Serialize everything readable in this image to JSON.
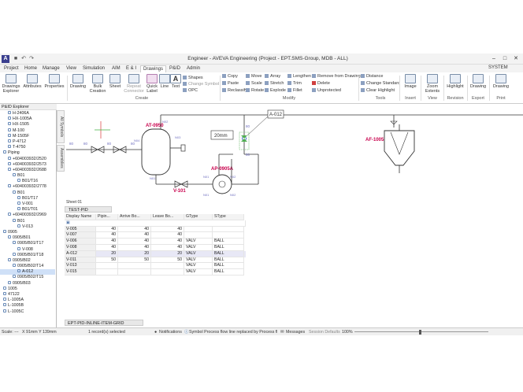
{
  "app": {
    "title": "Engineer - AVEVA Engineering (Project - EPT.SMS-Group, MDB - ALL)",
    "logo": "A",
    "user": "SYSTEM"
  },
  "menu_tabs": [
    "Project",
    "Home",
    "Manage",
    "View",
    "Simulation",
    "AIM",
    "E & I",
    "Drawings",
    "P&ID",
    "Admin"
  ],
  "active_tab": "Drawings",
  "ribbon": {
    "groups": {
      "create": "Create",
      "modify": "Modify",
      "tools": "Tools",
      "insert": "Insert",
      "view": "View",
      "revision": "Revision",
      "export": "Export",
      "print": "Print"
    },
    "drawings_explorer": "Drawings Explorer",
    "attributes": "Attributes",
    "properties": "Properties",
    "drawing": "Drawing",
    "bulk_creation": "Bulk Creation",
    "sheet": "Sheet",
    "repeat_connector": "Repeat Connector",
    "quick_label": "Quick Label",
    "line": "Line",
    "text": "Text",
    "shapes": "Shapes",
    "change_symbol": "Change Symbol",
    "opc": "OPC",
    "copy": "Copy",
    "paste": "Paste",
    "reclassify": "Reclassify",
    "move": "Move",
    "scale": "Scale",
    "rotate": "Rotate",
    "array": "Array",
    "stretch": "Stretch",
    "explode": "Explode",
    "lengthen": "Lengthen",
    "trim": "Trim",
    "fillet": "Fillet",
    "remove_from_drawing": "Remove from Drawing",
    "delete": "Delete",
    "unprotected": "Unprotected",
    "distance": "Distance",
    "change_standard": "Change Standard",
    "clear_highlight": "Clear Highlight",
    "image": "Image",
    "zoom_extents": "Zoom Extents",
    "highlight": "Highlight",
    "drawing_export": "Drawing",
    "drawing_print": "Drawing"
  },
  "explorer": {
    "title": "P&ID Explorer",
    "items": [
      {
        "label": "H-2406A",
        "indent": 1,
        "selected": false
      },
      {
        "label": "HX-1005A",
        "indent": 1,
        "selected": false
      },
      {
        "label": "HX-1505",
        "indent": 1,
        "selected": false
      },
      {
        "label": "M-100",
        "indent": 1,
        "selected": false
      },
      {
        "label": "M-1505F",
        "indent": 1,
        "selected": false
      },
      {
        "label": "P-4712",
        "indent": 1,
        "selected": false
      },
      {
        "label": "T-4750",
        "indent": 1,
        "selected": false
      },
      {
        "label": "Piping",
        "indent": 0,
        "selected": false
      },
      {
        "label": "+604003932/2520",
        "indent": 1,
        "selected": false
      },
      {
        "label": "+604003932/2573",
        "indent": 1,
        "selected": false
      },
      {
        "label": "+604003932/2688",
        "indent": 1,
        "selected": false
      },
      {
        "label": "B01",
        "indent": 2,
        "selected": false
      },
      {
        "label": "B01/T16",
        "indent": 3,
        "selected": false
      },
      {
        "label": "+604003932/2778",
        "indent": 1,
        "selected": false
      },
      {
        "label": "B01",
        "indent": 2,
        "selected": false
      },
      {
        "label": "B01/T17",
        "indent": 3,
        "selected": false
      },
      {
        "label": "V-001",
        "indent": 3,
        "selected": false
      },
      {
        "label": "B01/T01",
        "indent": 3,
        "selected": false
      },
      {
        "label": "+604003932/2969",
        "indent": 1,
        "selected": false
      },
      {
        "label": "B01",
        "indent": 2,
        "selected": false
      },
      {
        "label": "V-013",
        "indent": 3,
        "selected": false
      },
      {
        "label": "0905",
        "indent": 0,
        "selected": false
      },
      {
        "label": "0905/B01",
        "indent": 1,
        "selected": false
      },
      {
        "label": "0905/B01/T17",
        "indent": 2,
        "selected": false
      },
      {
        "label": "V-008",
        "indent": 3,
        "selected": false
      },
      {
        "label": "0905/B01/T18",
        "indent": 2,
        "selected": false
      },
      {
        "label": "0905/B02",
        "indent": 1,
        "selected": false
      },
      {
        "label": "0905/B02/T14",
        "indent": 2,
        "selected": false
      },
      {
        "label": "A-012",
        "indent": 3,
        "selected": true
      },
      {
        "label": "0905/B02/T15",
        "indent": 2,
        "selected": false
      },
      {
        "label": "0905/B03",
        "indent": 1,
        "selected": false
      },
      {
        "label": "1005",
        "indent": 0,
        "selected": false
      },
      {
        "label": "47122",
        "indent": 0,
        "selected": false
      },
      {
        "label": "L-1005A",
        "indent": 0,
        "selected": false
      },
      {
        "label": "L-1005B",
        "indent": 0,
        "selected": false
      },
      {
        "label": "L-1005C",
        "indent": 0,
        "selected": false
      }
    ]
  },
  "side_tabs": [
    "All Symbols",
    "Assemblies"
  ],
  "diagram": {
    "labels": {
      "at0950": "AT-0950",
      "ap0905a": "AP-0905A",
      "v101": "V-101",
      "af1005": "AF-1005",
      "a012": "A-012",
      "dim": "20mm",
      "n02": "N02",
      "n03": "N03",
      "n04": "N04",
      "n01": "N01",
      "n01b": "N01",
      "n02b": "N02",
      "n01c": "N01",
      "n02c": "N02",
      "b1": "80",
      "b2": "80",
      "b3": "80",
      "b4": "80",
      "b5": "80",
      "b6": "80"
    }
  },
  "sheet_tab": "Sheet 01",
  "grid_tab": "TEST-PID",
  "grid": {
    "columns": [
      "Display Name",
      "Pipin...",
      "Arrive Bo...",
      "Leave Bo...",
      "GType",
      "SType"
    ],
    "rows": [
      [
        "V-005",
        "40",
        "40",
        "40",
        "",
        ""
      ],
      [
        "V-007",
        "40",
        "40",
        "40",
        "",
        ""
      ],
      [
        "V-006",
        "40",
        "40",
        "40",
        "VALV",
        "BALL"
      ],
      [
        "V-008",
        "40",
        "40",
        "40",
        "VALV",
        "BALL"
      ],
      [
        "A-012",
        "20",
        "20",
        "20",
        "VALV",
        "BALL"
      ],
      [
        "V-011",
        "50",
        "50",
        "50",
        "VALV",
        "BALL"
      ],
      [
        "V-013",
        "",
        "",
        "",
        "VALV",
        "BALL"
      ],
      [
        "V-015",
        "",
        "",
        "",
        "VALV",
        "BALL"
      ]
    ],
    "current_row": 4
  },
  "bottom_tab": "EPT-PID-INLINE-ITEM-GRID",
  "status": {
    "scale": "Scale: ---",
    "coords": "X 91mm Y 139mm",
    "records": "1 record(s) selected",
    "notifications": "Notifications",
    "message": "Symbol Process flow line replaced by Process flow ...",
    "messages": "Messages",
    "session_defaults": "Session Defaults",
    "zoom": "100%"
  }
}
